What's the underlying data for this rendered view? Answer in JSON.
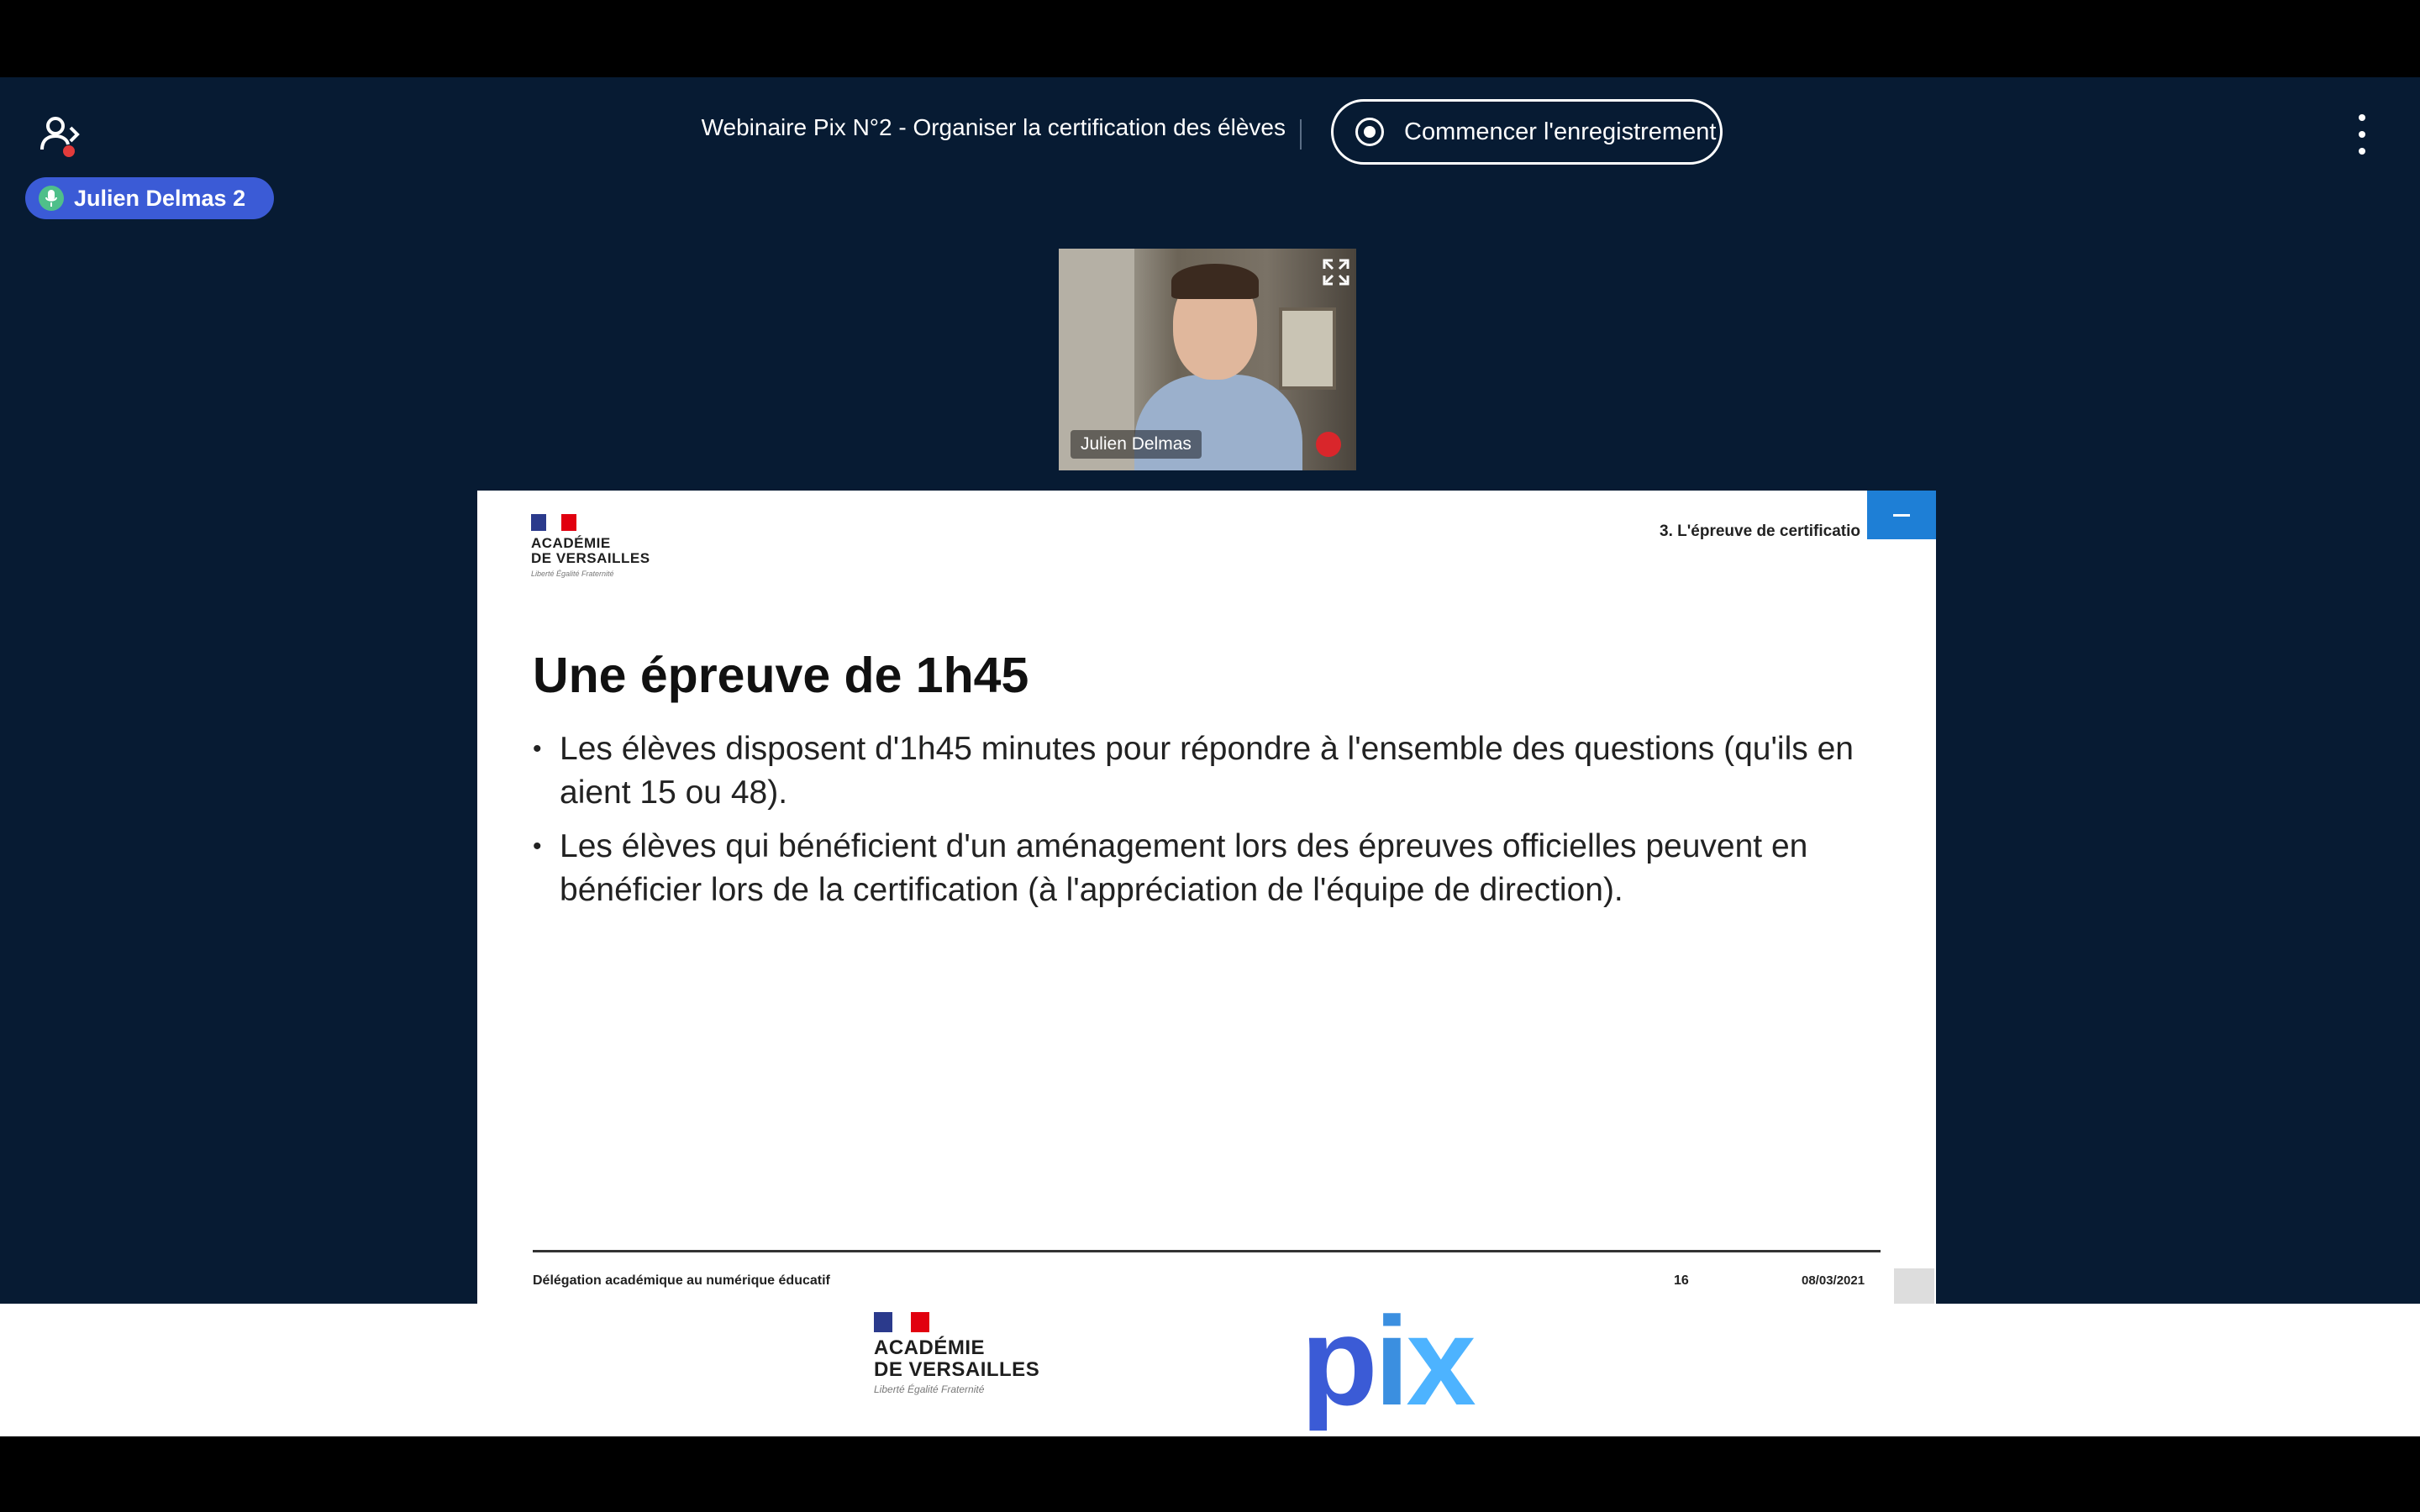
{
  "header": {
    "meeting_title": "Webinaire Pix N°2 - Organiser la certification des élèves",
    "record_label": "Commencer l'enregistrement",
    "speaker_name": "Julien Delmas 2",
    "icons": [
      "user-list-icon",
      "microphone-icon",
      "record-icon",
      "more-options-icon"
    ]
  },
  "webcam": {
    "participant_name": "Julien Delmas",
    "icons": [
      "expand-icon",
      "muted-microphone-icon"
    ]
  },
  "slide": {
    "logo_line1": "ACADÉMIE",
    "logo_line2": "DE VERSAILLES",
    "logo_motto": "Liberté Égalité Fraternité",
    "section": "3. L'épreuve de certificatio",
    "title": "Une épreuve de 1h45",
    "bullets": [
      "Les élèves disposent d'1h45 minutes pour répondre à l'ensemble des questions (qu'ils en aient 15 ou 48).",
      "Les élèves qui bénéficient d'un aménagement lors des épreuves officielles peuvent en bénéficier lors de la certification (à l'appréciation de l'équipe de direction)."
    ],
    "footer_left": "Délégation académique au numérique éducatif",
    "footer_page": "16",
    "footer_date": "08/03/2021"
  },
  "branding": {
    "academy_line1": "ACADÉMIE",
    "academy_line2": "DE VERSAILLES",
    "academy_motto": "Liberté Égalité Fraternité",
    "pix_p": "p",
    "pix_i": "i",
    "pix_x": "x"
  },
  "colors": {
    "app_background": "#071b33",
    "accent_blue": "#3b5bd6",
    "flag_blue": "#2b3a8c",
    "flag_red": "#e1000f"
  }
}
